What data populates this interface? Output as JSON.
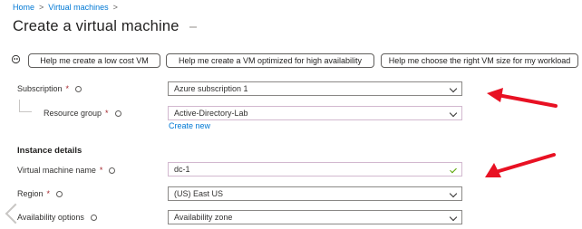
{
  "breadcrumb": {
    "home": "Home",
    "separator": ">",
    "virtual_machines": "Virtual machines"
  },
  "page": {
    "title": "Create a virtual machine"
  },
  "help_buttons": {
    "low_cost": "Help me create a low cost VM",
    "high_availability": "Help me create a VM optimized for high availability",
    "vm_size": "Help me choose the right VM size for my workload"
  },
  "form": {
    "subscription": {
      "label": "Subscription",
      "required": "*",
      "value": "Azure subscription 1"
    },
    "resource_group": {
      "label": "Resource group",
      "required": "*",
      "value": "Active-Directory-Lab",
      "create_new": "Create new"
    },
    "instance_details": {
      "heading": "Instance details"
    },
    "vm_name": {
      "label": "Virtual machine name",
      "required": "*",
      "value": "dc-1"
    },
    "region": {
      "label": "Region",
      "required": "*",
      "value": "(US) East US"
    },
    "availability": {
      "label": "Availability options",
      "value": "Availability zone"
    }
  },
  "colors": {
    "link": "#0078d4",
    "required": "#a4262c",
    "arrow": "#e81123",
    "valid": "#57a300"
  }
}
